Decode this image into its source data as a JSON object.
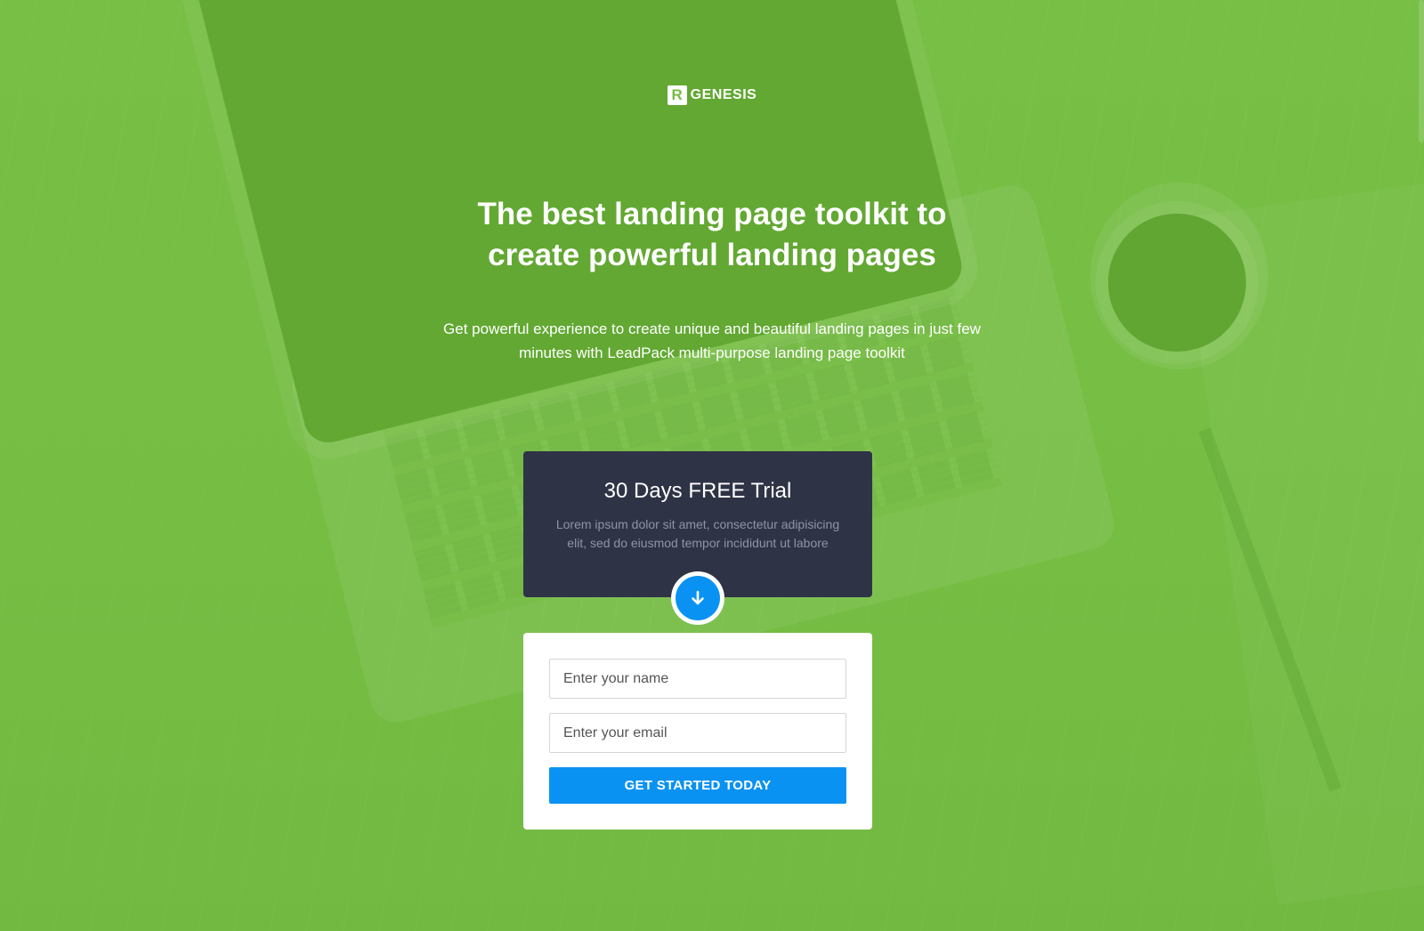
{
  "brand": {
    "logo_mark": "R",
    "logo_text": "GENESIS"
  },
  "hero": {
    "headline_line1": "The best landing page toolkit to",
    "headline_line2": "create powerful landing pages",
    "subhead_line1": "Get powerful experience to create unique and beautiful landing pages in just few",
    "subhead_line2": "minutes with LeadPack multi-purpose landing page toolkit"
  },
  "trial": {
    "title": "30 Days FREE Trial",
    "description_line1": "Lorem ipsum dolor sit amet, consectetur adipisicing",
    "description_line2": "elit, sed do eiusmod tempor incididunt ut labore"
  },
  "form": {
    "name_placeholder": "Enter your name",
    "email_placeholder": "Enter your email",
    "submit_label": "GET STARTED TODAY"
  },
  "icons": {
    "scroll": "arrow-down-icon"
  },
  "colors": {
    "background": "#76bd44",
    "card_dark": "#2f3346",
    "accent": "#0a92f3",
    "white": "#ffffff"
  }
}
